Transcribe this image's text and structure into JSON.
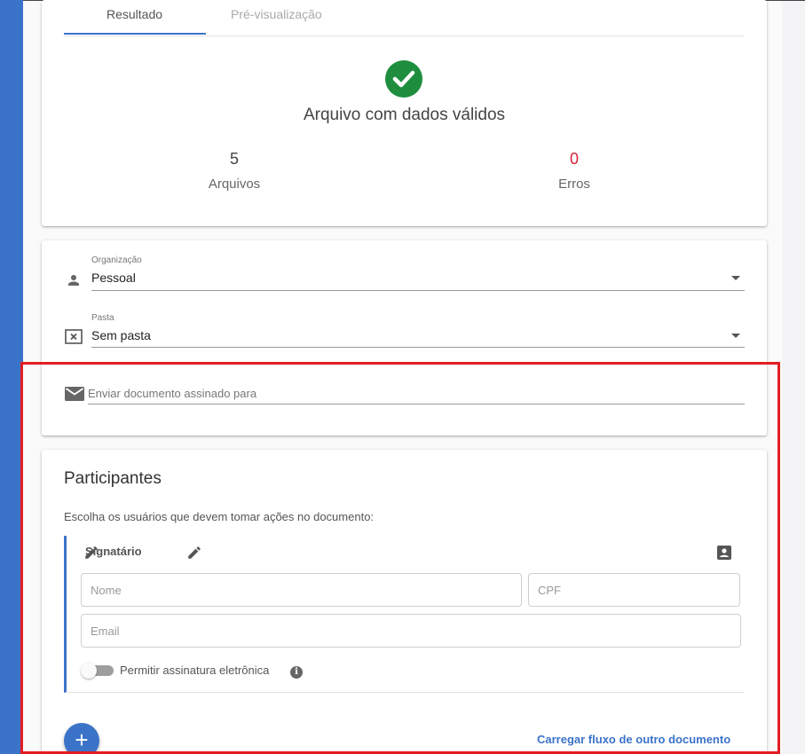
{
  "tabs": [
    {
      "label": "Resultado",
      "active": true
    },
    {
      "label": "Pré-visualização",
      "active": false
    }
  ],
  "result": {
    "status_icon": "check-circle-icon",
    "title": "Arquivo com dados válidos",
    "files_count": "5",
    "files_label": "Arquivos",
    "errors_count": "0",
    "errors_label": "Erros",
    "error_color": "#d8243a",
    "success_color": "#1e8e3e"
  },
  "organization": {
    "label": "Organização",
    "value": "Pessoal",
    "icon": "person-icon"
  },
  "folder": {
    "label": "Pasta",
    "value": "Sem pasta",
    "icon": "folder-x-icon"
  },
  "send_to": {
    "placeholder": "Enviar documento assinado para",
    "icon": "mail-icon"
  },
  "participants": {
    "title": "Participantes",
    "description": "Escolha os usuários que devem tomar ações no documento:",
    "role": "Signatário",
    "name_placeholder": "Nome",
    "cpf_placeholder": "CPF",
    "email_placeholder": "Email",
    "toggle_label": "Permitir assinatura eletrônica",
    "toggle_on": false,
    "info_icon": "info-icon",
    "add_button": "+",
    "load_flow_link": "Carregar fluxo de outro documento"
  },
  "colors": {
    "accent": "#3b73c9",
    "highlight": "#e31d24"
  }
}
